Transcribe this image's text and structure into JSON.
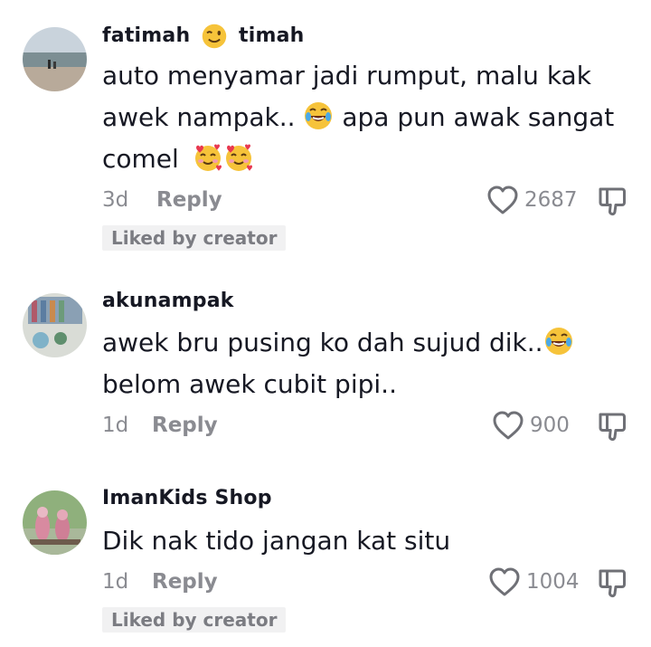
{
  "comments": [
    {
      "username_part1": "fatimah",
      "username_emoji": "winking-face-emoji",
      "username_part2": "timah",
      "line1": "auto menyamar jadi rumput, malu kak",
      "line2_a": "awek nampak..",
      "line2_emoji": "face-with-tears-of-joy-emoji",
      "line2_b": "apa pun awak sangat",
      "line3": "comel",
      "line3_emoji": "smiling-face-with-hearts-emoji",
      "time": "3d",
      "reply_label": "Reply",
      "likes": "2687",
      "badge": "Liked by creator"
    },
    {
      "username": "akunampak",
      "line1": "awek bru pusing ko dah sujud dik..",
      "line1_emoji": "face-with-tears-of-joy-emoji",
      "line2": "belom awek cubit pipi..",
      "time": "1d",
      "reply_label": "Reply",
      "likes": "900"
    },
    {
      "username": "ImanKids Shop",
      "line1": "Dik nak tido jangan kat situ",
      "time": "1d",
      "reply_label": "Reply",
      "likes": "1004",
      "badge": "Liked by creator"
    }
  ],
  "icons": {
    "like": "heart-outline-icon",
    "dislike": "thumbs-down-outline-icon"
  },
  "colors": {
    "text": "#161823",
    "secondary": "#8a8b91",
    "badge_bg": "#f1f1f2"
  }
}
